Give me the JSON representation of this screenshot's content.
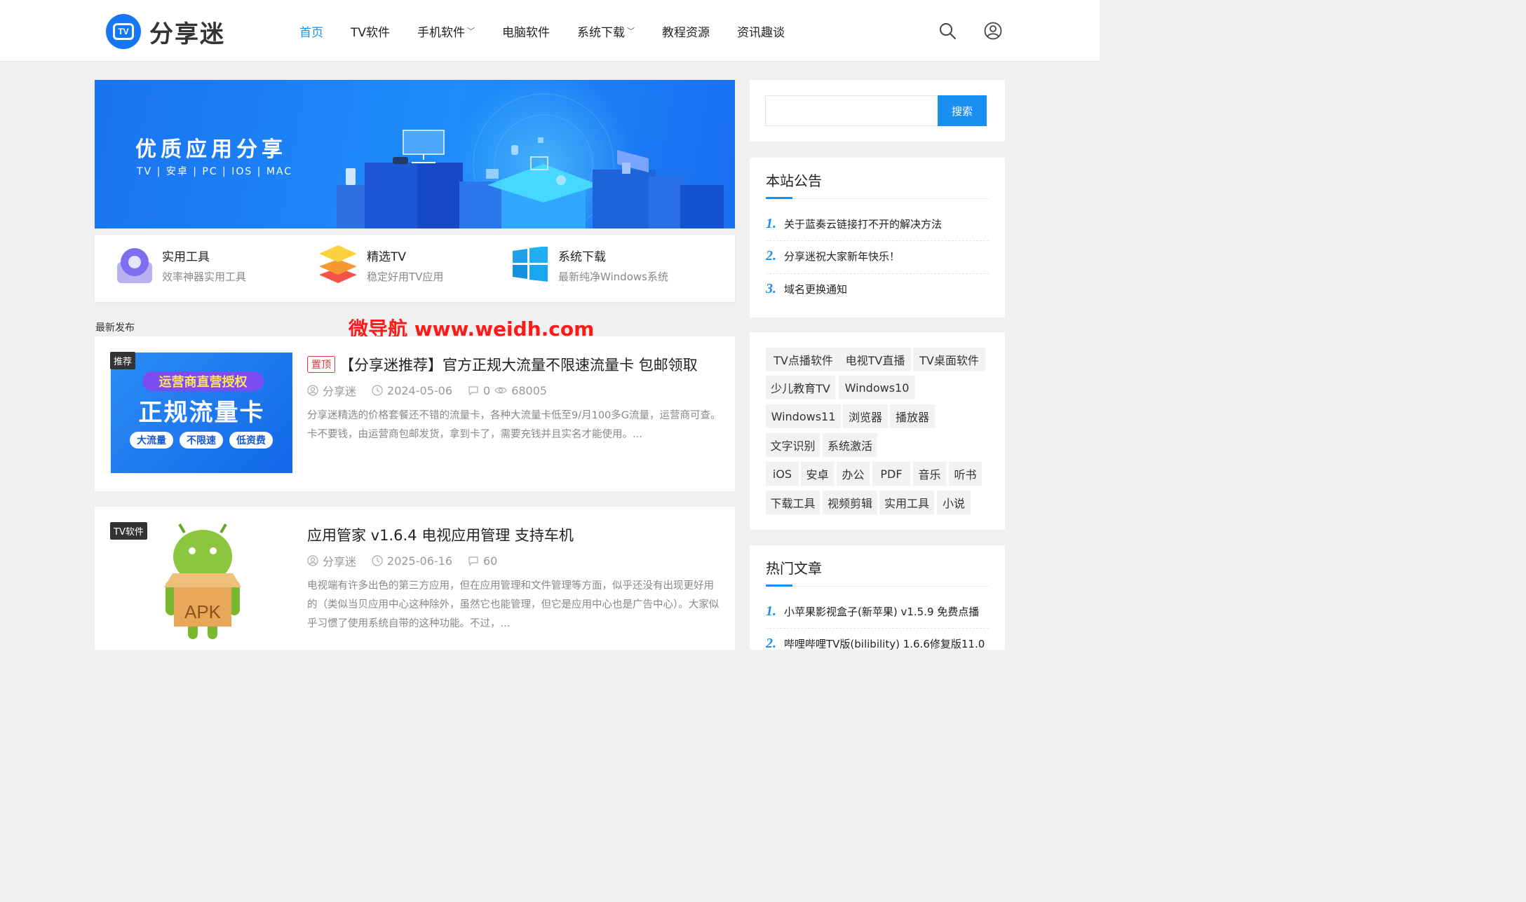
{
  "header": {
    "logo_badge": "TV",
    "logo_text": "分享迷",
    "nav": [
      {
        "label": "首页",
        "active": true,
        "has_dropdown": false
      },
      {
        "label": "TV软件",
        "active": false,
        "has_dropdown": false
      },
      {
        "label": "手机软件",
        "active": false,
        "has_dropdown": true
      },
      {
        "label": "电脑软件",
        "active": false,
        "has_dropdown": false
      },
      {
        "label": "系统下载",
        "active": false,
        "has_dropdown": true
      },
      {
        "label": "教程资源",
        "active": false,
        "has_dropdown": false
      },
      {
        "label": "资讯趣谈",
        "active": false,
        "has_dropdown": false
      }
    ],
    "icons": [
      "search-icon",
      "user-icon"
    ]
  },
  "banner": {
    "title": "优质应用分享",
    "subtitle": "TV | 安卓 | PC | IOS | MAC"
  },
  "categories": [
    {
      "title": "实用工具",
      "desc": "效率神器实用工具",
      "icon": "toolbox-icon"
    },
    {
      "title": "精选TV",
      "desc": "稳定好用TV应用",
      "icon": "layers-icon"
    },
    {
      "title": "系统下载",
      "desc": "最新纯净Windows系统",
      "icon": "windows-icon"
    }
  ],
  "section_label": "最新发布",
  "watermark": "微导航 www.weidh.com",
  "posts": [
    {
      "tag": "推荐",
      "sticky_label": "置顶",
      "title": "【分享迷推荐】官方正规大流量不限速流量卡 包邮领取",
      "author": "分享迷",
      "date": "2024-05-06",
      "comments": "0",
      "views": "68005",
      "excerpt": "分享迷精选的价格套餐还不错的流量卡，各种大流量卡低至9/月100多G流量，运营商可查。卡不要钱，由运营商包邮发货，拿到卡了，需要充钱并且实名才能使用。...",
      "thumb": {
        "line1": "运营商直营授权",
        "line2": "正规流量卡",
        "pills": [
          "大流量",
          "不限速",
          "低资费"
        ]
      }
    },
    {
      "tag": "TV软件",
      "title": "应用管家 v1.6.4 电视应用管理 支持车机",
      "author": "分享迷",
      "date": "2025-06-16",
      "comments": "60",
      "excerpt": "电视端有许多出色的第三方应用，但在应用管理和文件管理等方面，似乎还没有出现更好用的（类似当贝应用中心这种除外，虽然它也能管理，但它是应用中心也是广告中心）。大家似乎习惯了使用系统自带的这种功能。不过，...",
      "thumb": {
        "label": "APK"
      }
    }
  ],
  "sidebar": {
    "search_button": "搜索",
    "search_placeholder": "",
    "announcements": {
      "title": "本站公告",
      "items": [
        {
          "num": "1.",
          "text": "关于蓝奏云链接打不开的解决方法"
        },
        {
          "num": "2.",
          "text": "分享迷祝大家新年快乐！"
        },
        {
          "num": "3.",
          "text": "域名更换通知"
        }
      ]
    },
    "tags": [
      "TV点播软件",
      "电视TV直播",
      "TV桌面软件",
      "少儿教育TV",
      "Windows10",
      "Windows11",
      "浏览器",
      "播放器",
      "文字识别",
      "系统激活",
      "iOS",
      "安卓",
      "办公",
      "PDF",
      "音乐",
      "听书",
      "下载工具",
      "视频剪辑",
      "实用工具",
      "小说"
    ],
    "hot": {
      "title": "热门文章",
      "items": [
        {
          "num": "1.",
          "text": "小苹果影视盒子(新苹果) v1.5.9 免费点播"
        },
        {
          "num": "2.",
          "text": "哔哩哔哩TV版(bilibility) 1.6.6修复版11.0"
        }
      ]
    }
  },
  "colors": {
    "accent": "#1a8ff2",
    "banner": "#1e84f7",
    "sticky": "#e03434",
    "watermark": "#ff1a1a"
  }
}
